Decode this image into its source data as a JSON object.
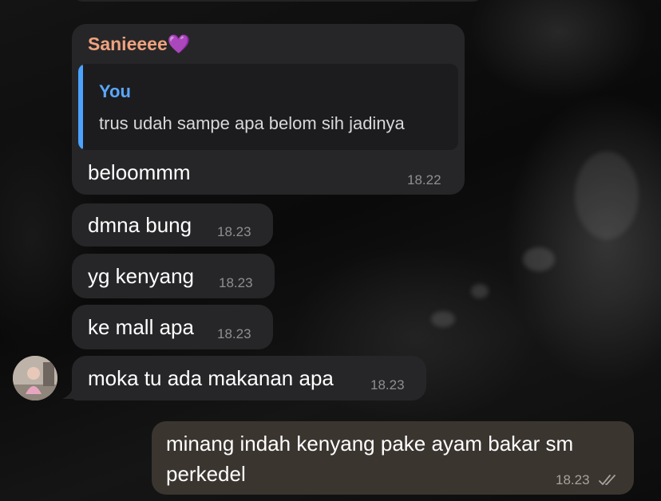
{
  "messages": [
    {
      "sender": "Sanieeee💜",
      "quote": {
        "author": "You",
        "text": "trus udah sampe apa belom sih jadinya"
      },
      "text": "beloommm",
      "time": "18.22"
    },
    {
      "text": "dmna bung",
      "time": "18.23"
    },
    {
      "text": "yg kenyang",
      "time": "18.23"
    },
    {
      "text": "ke mall apa",
      "time": "18.23"
    },
    {
      "text": "moka tu ada makanan apa",
      "time": "18.23"
    }
  ],
  "outgoing": {
    "line1": "minang indah kenyang pake ayam bakar sm",
    "line2": "perkedel",
    "time": "18.23",
    "status_icon": "double-check-icon"
  },
  "avatar_icon": "contact-avatar",
  "colors": {
    "incoming_bubble": "#262628",
    "outgoing_bubble": "#3b3530",
    "sender_name": "#f0a27e",
    "quote_accent": "#4aa3ff",
    "timestamp": "#8f8f93"
  }
}
